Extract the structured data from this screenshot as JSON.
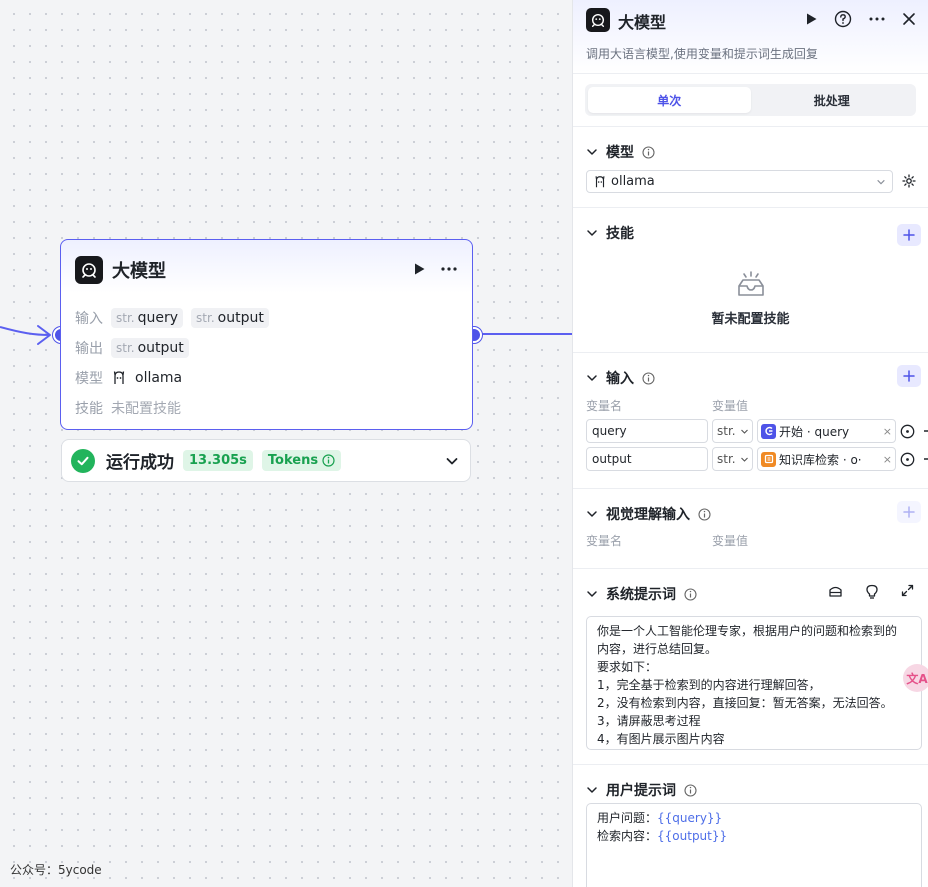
{
  "canvas": {
    "node": {
      "title": "大模型",
      "rows": {
        "input_label": "输入",
        "input_vars": [
          {
            "type": "str.",
            "name": "query"
          },
          {
            "type": "str.",
            "name": "output"
          }
        ],
        "output_label": "输出",
        "output_var": {
          "type": "str.",
          "name": "output"
        },
        "model_label": "模型",
        "model_value": "ollama",
        "skill_label": "技能",
        "skill_value": "未配置技能"
      }
    },
    "run_status": {
      "text": "运行成功",
      "duration": "13.305s",
      "tokens_label": "Tokens"
    },
    "watermark": "公众号：5ycode"
  },
  "panel": {
    "title": "大模型",
    "description": "调用大语言模型,使用变量和提示词生成回复",
    "tabs": [
      {
        "label": "单次",
        "active": true
      },
      {
        "label": "批处理",
        "active": false
      }
    ],
    "model_section": {
      "title": "模型",
      "selected": "ollama"
    },
    "skill_section": {
      "title": "技能",
      "empty_text": "暂未配置技能"
    },
    "input_section": {
      "title": "输入",
      "col_name": "变量名",
      "col_value": "变量值",
      "rows": [
        {
          "name": "query",
          "type": "str.",
          "source": "开始",
          "value": "query",
          "source_color": "#4e53e8"
        },
        {
          "name": "output",
          "type": "str.",
          "source": "知识库检索",
          "value": "o·",
          "source_color": "#f08a24"
        }
      ]
    },
    "vision_section": {
      "title": "视觉理解输入",
      "col_name": "变量名",
      "col_value": "变量值"
    },
    "system_prompt": {
      "title": "系统提示词",
      "lines": [
        "你是一个人工智能伦理专家，根据用户的问题和检索到的",
        "内容，进行总结回复。",
        "要求如下：",
        "1，完全基于检索到的内容进行理解回答，",
        "2，没有检索到内容，直接回复：暂无答案，无法回答。",
        "3，请屏蔽思考过程",
        "4，有图片展示图片内容"
      ]
    },
    "user_prompt": {
      "title": "用户提示词",
      "line1_label": "用户问题：",
      "line1_var": "{{query}}",
      "line2_label": "检索内容：",
      "line2_var": "{{output}}"
    }
  },
  "floating": {
    "translate": "文A"
  },
  "colors": {
    "accent": "#4e53e8",
    "success": "#22b45c"
  }
}
